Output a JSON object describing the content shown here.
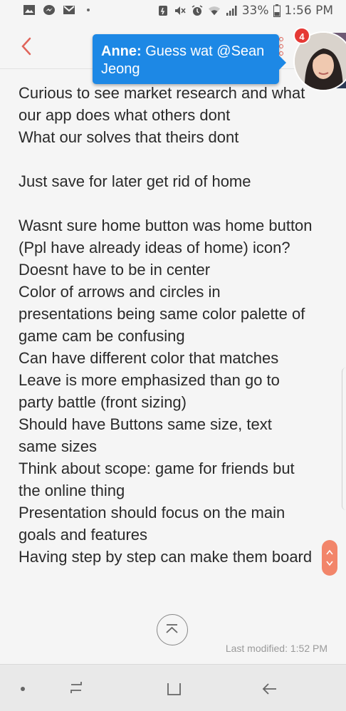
{
  "status_bar": {
    "left_icons": [
      "gallery-icon",
      "messenger-icon",
      "gmail-icon"
    ],
    "right_icons": [
      "battery-saver-icon",
      "mute-icon",
      "alarm-icon",
      "wifi-icon",
      "signal-icon",
      "battery-icon"
    ],
    "battery": "33%",
    "time": "1:56 PM"
  },
  "header": {
    "back_icon": "chevron-left-icon",
    "more_icon": "more-vertical-icon",
    "accent_color": "#e0645a"
  },
  "chat_head": {
    "sender": "Anne:",
    "message": "Guess wat @Sean Jeong",
    "unread_count": "4",
    "bubble_color": "#1d88e5",
    "badge_color": "#e53935"
  },
  "note": {
    "lines": [
      "Curious to see market research and what",
      "our app does what others dont",
      "What our solves that theirs dont",
      "",
      "Just save for later get rid of home",
      "",
      "Wasnt sure home button was home button",
      "(Ppl have already ideas of home) icon?",
      "Doesnt have to be in center",
      "Color of arrows and circles in",
      "presentations being same color palette of",
      "game cam be confusing",
      "Can have different color that matches",
      "Leave is more emphasized than go to",
      "party battle (front sizing)",
      "Should have Buttons same size, text",
      "same sizes",
      "Think about scope: game for friends but",
      "the online thing",
      "Presentation should focus on the main",
      "goals and features",
      "Having step by step can make them board"
    ]
  },
  "footer": {
    "scroll_top_icon": "scroll-to-top-icon",
    "last_modified": "Last modified: 1:52 PM"
  },
  "nav_bar": {
    "items": [
      "recents-icon",
      "home-icon",
      "back-icon"
    ]
  }
}
